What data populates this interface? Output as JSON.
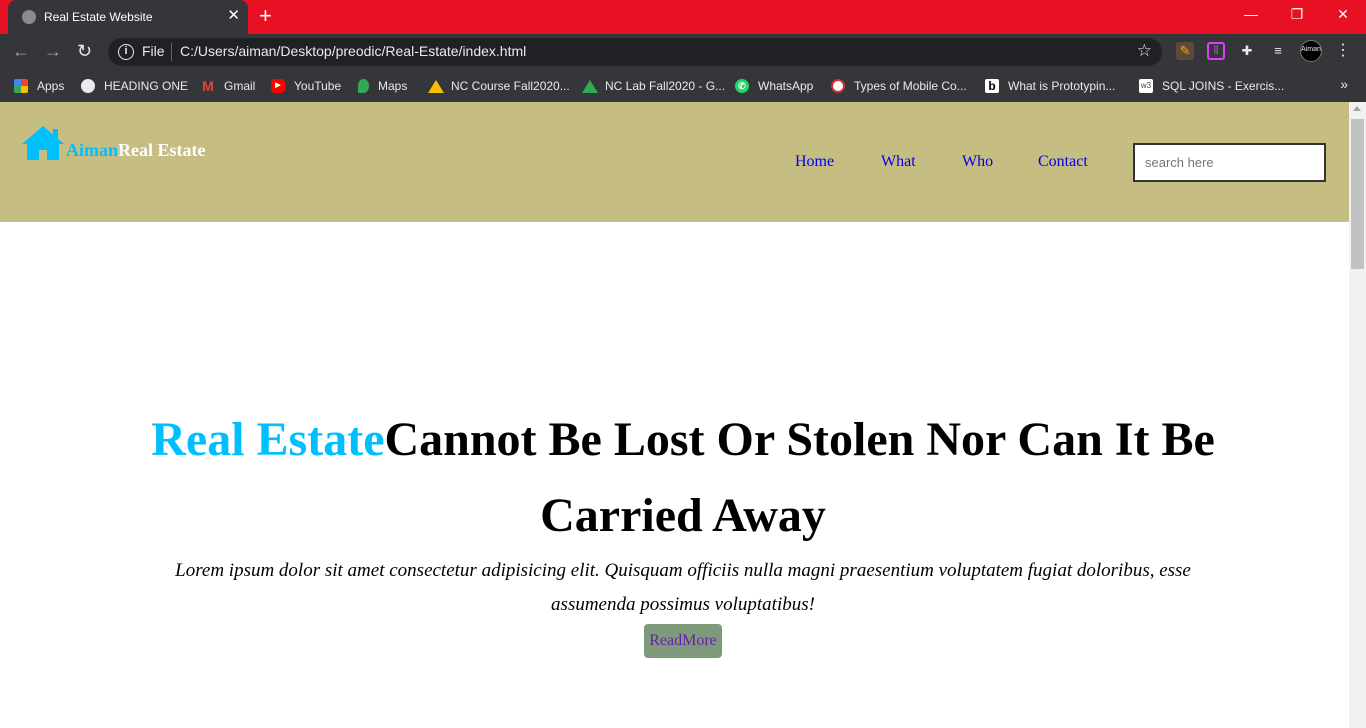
{
  "browser": {
    "tab_title": "Real Estate Website",
    "tab_close": "✕",
    "new_tab": "+",
    "scheme_label": "File",
    "url": "C:/Users/aiman/Desktop/preodic/Real-Estate/index.html",
    "avatar_label": "Aiman",
    "window_controls": {
      "minimize": "—",
      "restore": "❐",
      "close": "✕"
    },
    "bookmarks": [
      {
        "label": "Apps",
        "icon": "apps-grid-icon"
      },
      {
        "label": "HEADING ONE",
        "icon": "globe-icon"
      },
      {
        "label": "Gmail",
        "icon": "gmail-icon"
      },
      {
        "label": "YouTube",
        "icon": "youtube-icon"
      },
      {
        "label": "Maps",
        "icon": "maps-icon"
      },
      {
        "label": "NC Course Fall2020...",
        "icon": "google-drive-icon"
      },
      {
        "label": "NC Lab Fall2020 - G...",
        "icon": "google-drive-icon"
      },
      {
        "label": "WhatsApp",
        "icon": "whatsapp-icon"
      },
      {
        "label": "Types of Mobile Co...",
        "icon": "site-icon"
      },
      {
        "label": "What is Prototypin...",
        "icon": "site-icon"
      },
      {
        "label": "SQL JOINS - Exercis...",
        "icon": "w3schools-icon"
      }
    ],
    "w3_fav_text": "w3",
    "bookmarks_more": "»"
  },
  "site": {
    "brand_part1": "Aiman",
    "brand_part2": "Real Estate",
    "brand_color": "#00bfff",
    "header_color": "#c6bd83",
    "nav": [
      "Home",
      "What",
      "Who",
      "Contact"
    ],
    "search_placeholder": "search here"
  },
  "hero": {
    "title_accent": "Real Estate",
    "title_rest": "Cannot Be Lost Or Stolen Nor Can It Be Carried Away",
    "body": "Lorem ipsum dolor sit amet consectetur adipisicing elit. Quisquam officiis nulla magni praesentium voluptatem fugiat doloribus, esse assumenda possimus voluptatibus!",
    "button_label": "ReadMore"
  }
}
